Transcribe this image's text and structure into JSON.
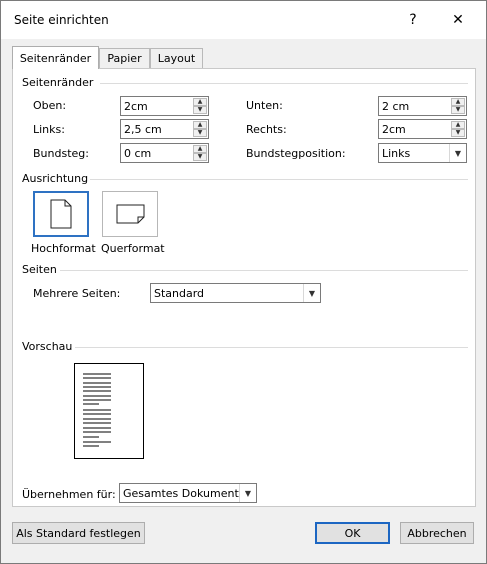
{
  "title": "Seite einrichten",
  "title_buttons": {
    "help": "?",
    "close": "✕"
  },
  "tabs": [
    "Seitenränder",
    "Papier",
    "Layout"
  ],
  "margins_group": {
    "label": "Seitenränder",
    "top_label": "Oben:",
    "top_value": "2cm",
    "bottom_label": "Unten:",
    "bottom_value": "2 cm",
    "left_label": "Links:",
    "left_value": "2,5 cm",
    "right_label": "Rechts:",
    "right_value": "2cm",
    "gutter_label": "Bundsteg:",
    "gutter_value": "0 cm",
    "gutter_pos_label": "Bundstegposition:",
    "gutter_pos_value": "Links"
  },
  "orientation_group": {
    "label": "Ausrichtung",
    "portrait": "Hochformat",
    "landscape": "Querformat",
    "selected": "Hochformat"
  },
  "pages_group": {
    "label": "Seiten",
    "multiple_label": "Mehrere Seiten:",
    "multiple_value": "Standard"
  },
  "preview_group": {
    "label": "Vorschau"
  },
  "apply": {
    "label": "Übernehmen für:",
    "value": "Gesamtes Dokument"
  },
  "buttons": {
    "set_default": "Als Standard festlegen",
    "ok": "OK",
    "cancel": "Abbrechen"
  },
  "colors": {
    "accent": "#2e72c3",
    "dialog_bg": "#f0f0f0",
    "panel_bg": "#ffffff"
  }
}
